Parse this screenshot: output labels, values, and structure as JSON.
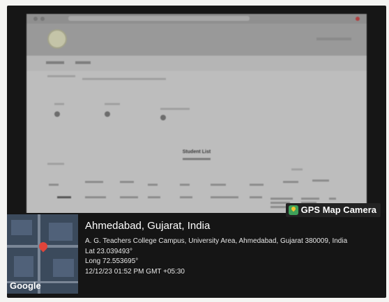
{
  "screen": {
    "page_title": "Student List"
  },
  "gps_stamp": {
    "badge_label": "GPS Map Camera",
    "city": "Ahmedabad, Gujarat, India",
    "address": "A. G. Teachers College Campus, University Area, Ahmedabad, Gujarat 380009, India",
    "lat": "Lat 23.039493°",
    "long": "Long 72.553695°",
    "timestamp": "12/12/23 01:52 PM GMT +05:30",
    "map_brand": "Google"
  },
  "colors": {
    "map_pin": "#e0443a",
    "badge_icon": "#3fa15a"
  }
}
